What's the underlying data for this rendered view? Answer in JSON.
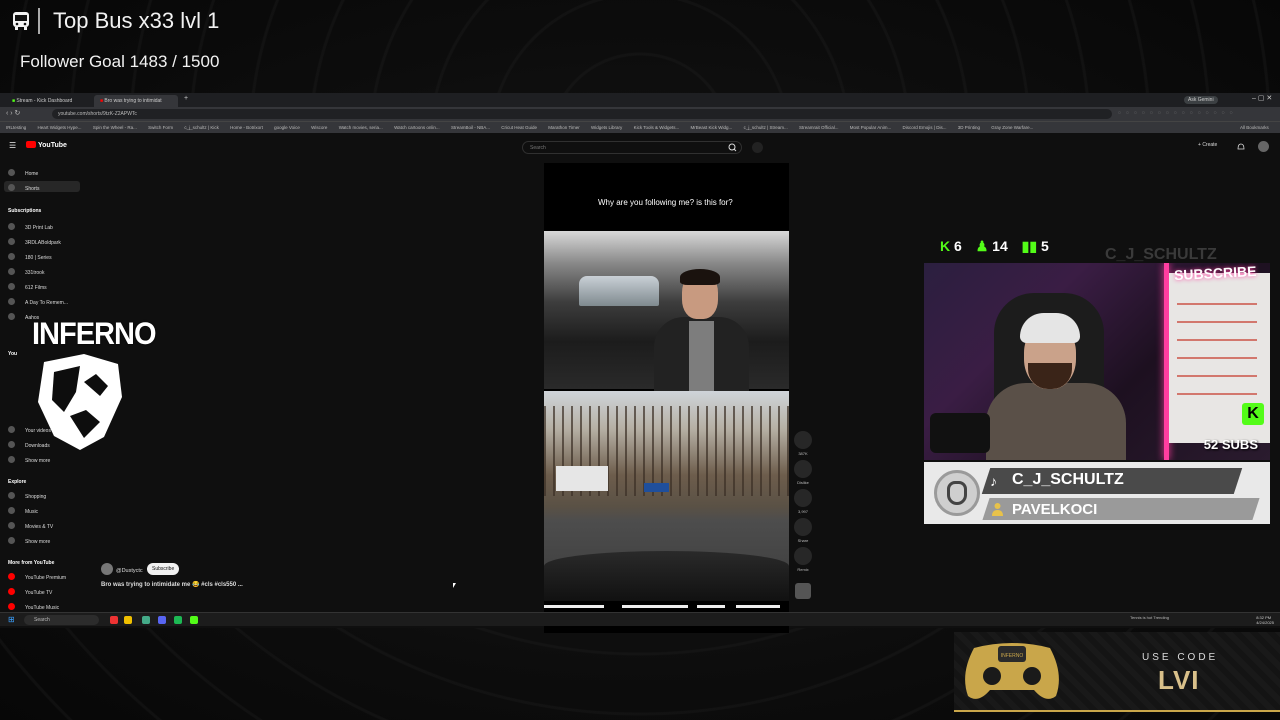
{
  "overlay": {
    "title": "Top Bus   x33   lvl 1",
    "follower_goal": "Follower Goal 1483 / 1500"
  },
  "browser": {
    "tabs": [
      "Stream - Kick Dashboard",
      "Bro was trying to intimidat"
    ],
    "url": "youtube.com/shorts/9tzK-Z2APWTc",
    "bookmarks": [
      "IRLtesting",
      "Heart Widgets Hype...",
      "Spin the Wheel - Ra...",
      "Switch Form",
      "c_j_schultz | Kick",
      "Home - Botrixort",
      "google Voice",
      "Wiscore",
      "Watch movies, seria...",
      "Watch cartoons onlin...",
      "StreamBoil - NBA...",
      "Cricut Heat Guide",
      "Marathon Timer",
      "Widgets Library",
      "Kick Tools & Widgets...",
      "MrBeast Kick Widg...",
      "c_j_schultz | Stream...",
      "Streamrait Official...",
      "Most Popular Anim...",
      "Discord Emojis | Dis...",
      "3D Printing",
      "Gray Zone Warfare..."
    ],
    "extension_label": "Ask Gemini",
    "all_bookmarks": "All Bookmarks"
  },
  "youtube": {
    "logo": "YouTube",
    "search_placeholder": "Search",
    "create_label": "Create",
    "sidebar": {
      "home": "Home",
      "shorts": "Shorts",
      "subscriptions_head": "Subscriptions",
      "subscriptions": [
        "3D Print Lab",
        "3RDLABoldpark",
        "180 | Series",
        "331trook",
        "612 Films",
        "A Day To Remem...",
        "Aahos"
      ],
      "you_head": "You",
      "you_items": [
        "Your videos",
        "Downloads",
        "Show more"
      ],
      "explore_head": "Explore",
      "explore_items": [
        "Shopping",
        "Music",
        "Movies & TV",
        "Show more"
      ],
      "more_head": "More from YouTube",
      "more_items": [
        "YouTube Premium",
        "YouTube TV",
        "YouTube Music"
      ]
    },
    "short": {
      "caption": "Why are you following me? is this for?",
      "channel": "@Dustyctc",
      "subscribe": "Subscribe",
      "title": "Bro was trying to intimidate me 😂 #cls #cls550 ...",
      "likes": "387K",
      "dislike": "Dislike",
      "comments": "3,997",
      "share": "Share",
      "remix": "Remix"
    }
  },
  "taskbar": {
    "search": "Search",
    "weather": "Tennis is hot Trending",
    "time": "8:32 PM",
    "date": "4/24/2025"
  },
  "logo_text": "INFERNO",
  "stream": {
    "kick_count": "6",
    "followers_count": "14",
    "viewers_count": "5",
    "watermark": "C_J_SCHULTZ",
    "subscribe_sign": "SUBSCRIBE",
    "subs": "52 SUBS",
    "k_badge": "K",
    "name": "C_J_SCHULTZ",
    "latest_follower": "PAVELKOCI"
  },
  "ad": {
    "use_code": "USE CODE",
    "code": "LVI",
    "controller_brand": "INFERNO"
  },
  "colors": {
    "kick_green": "#53fc18",
    "youtube_red": "#ff0000",
    "neon_pink": "#ff3ea0",
    "gold": "#d9c08a"
  }
}
